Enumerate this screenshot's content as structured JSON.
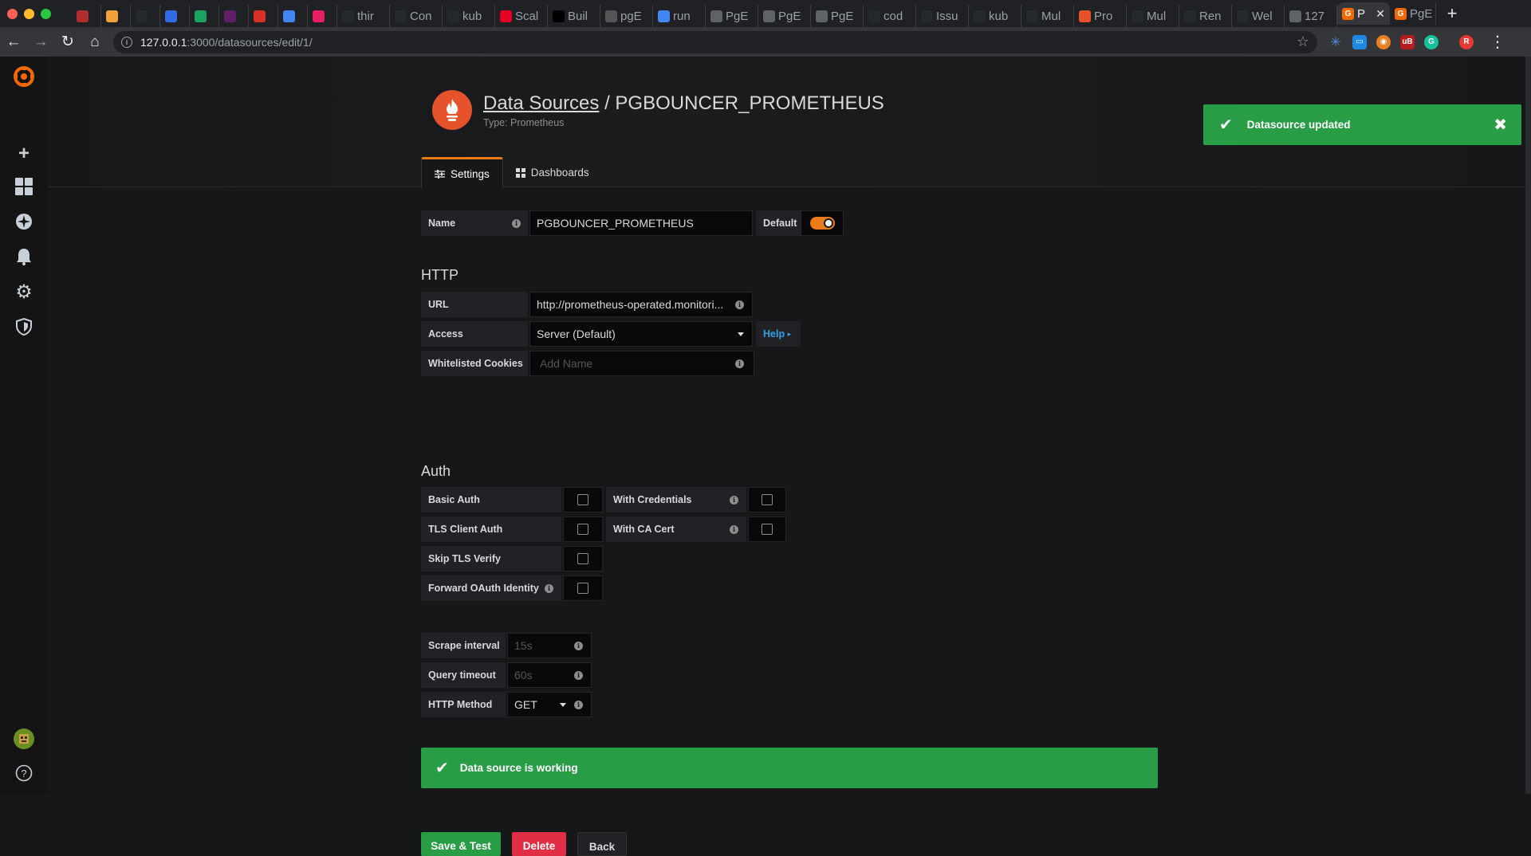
{
  "browser": {
    "tabs": [
      {
        "label": "",
        "icon": "bug-icon",
        "color": "#b22e2e"
      },
      {
        "label": "",
        "icon": "o-icon",
        "color": "#f2a23b"
      },
      {
        "label": "",
        "icon": "github-icon",
        "color": "#24292e"
      },
      {
        "label": "",
        "icon": "kubernetes-icon",
        "color": "#326ce5"
      },
      {
        "label": "",
        "icon": "c-icon",
        "color": "#1aa260"
      },
      {
        "label": "",
        "icon": "slack-icon",
        "color": "#611f69"
      },
      {
        "label": "",
        "icon": "gmail-icon",
        "color": "#d93025"
      },
      {
        "label": "",
        "icon": "docs-icon",
        "color": "#4285f4"
      },
      {
        "label": "",
        "icon": "eye-icon",
        "color": "#e91e63"
      },
      {
        "label": "thir",
        "icon": "github-icon",
        "color": "#24292e"
      },
      {
        "label": "Con",
        "icon": "github-icon",
        "color": "#24292e"
      },
      {
        "label": "kub",
        "icon": "github-icon",
        "color": "#24292e"
      },
      {
        "label": "Scal",
        "icon": "pinterest-icon",
        "color": "#e60023"
      },
      {
        "label": "Buil",
        "icon": "medium-icon",
        "color": "#000000"
      },
      {
        "label": "pgE",
        "icon": "image-icon",
        "color": "#555555"
      },
      {
        "label": "run",
        "icon": "docs-icon",
        "color": "#4285f4"
      },
      {
        "label": "PgE",
        "icon": "globe-icon",
        "color": "#5f6368"
      },
      {
        "label": "PgE",
        "icon": "globe-icon",
        "color": "#5f6368"
      },
      {
        "label": "PgE",
        "icon": "globe-icon",
        "color": "#5f6368"
      },
      {
        "label": "cod",
        "icon": "github-icon",
        "color": "#24292e"
      },
      {
        "label": "Issu",
        "icon": "github-icon",
        "color": "#24292e"
      },
      {
        "label": "kub",
        "icon": "github-icon",
        "color": "#24292e"
      },
      {
        "label": "Mul",
        "icon": "github-icon",
        "color": "#24292e"
      },
      {
        "label": "Pro",
        "icon": "prometheus-icon",
        "color": "#e6522c"
      },
      {
        "label": "Mul",
        "icon": "github-icon",
        "color": "#24292e"
      },
      {
        "label": "Ren",
        "icon": "github-icon",
        "color": "#24292e"
      },
      {
        "label": "Wel",
        "icon": "github-icon",
        "color": "#24292e"
      },
      {
        "label": "127",
        "icon": "globe-icon",
        "color": "#5f6368"
      }
    ],
    "active_tab": {
      "label": "P"
    },
    "last_tab": {
      "label": "PgE"
    },
    "url_host": "127.0.0.1",
    "url_path": ":3000/datasources/edit/1/",
    "profile_initial": "R"
  },
  "page": {
    "breadcrumb_link": "Data Sources",
    "breadcrumb_sep": " / ",
    "title": "PGBOUNCER_PROMETHEUS",
    "subtitle": "Type: Prometheus",
    "tab_settings": "Settings",
    "tab_dashboards": "Dashboards"
  },
  "toast": {
    "message": "Datasource updated"
  },
  "form": {
    "name_label": "Name",
    "name_value": "PGBOUNCER_PROMETHEUS",
    "default_label": "Default",
    "http_heading": "HTTP",
    "url_label": "URL",
    "url_value": "http://prometheus-operated.monitori...",
    "access_label": "Access",
    "access_value": "Server (Default)",
    "help_label": "Help",
    "cookies_label": "Whitelisted Cookies",
    "cookies_placeholder": "Add Name",
    "auth_heading": "Auth",
    "basic_auth": "Basic Auth",
    "with_credentials": "With Credentials",
    "tls_client_auth": "TLS Client Auth",
    "with_ca_cert": "With CA Cert",
    "skip_tls": "Skip TLS Verify",
    "forward_oauth": "Forward OAuth Identity",
    "scrape_label": "Scrape interval",
    "scrape_placeholder": "15s",
    "timeout_label": "Query timeout",
    "timeout_placeholder": "60s",
    "method_label": "HTTP Method",
    "method_value": "GET"
  },
  "status": {
    "message": "Data source is working"
  },
  "buttons": {
    "save": "Save & Test",
    "delete": "Delete",
    "back": "Back"
  },
  "colors": {
    "success": "#299c46",
    "danger": "#e02f44",
    "accent": "#eb7b18",
    "prometheus": "#e6522c"
  }
}
